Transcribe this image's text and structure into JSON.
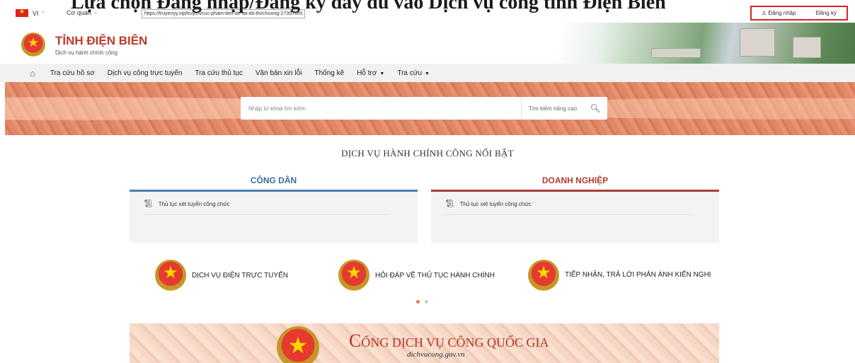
{
  "overlay": {
    "heading": "Lựa chọn Đăng nhập/Đăng ký đầy đủ vào Dịch vụ công tỉnh Điện Biên"
  },
  "topbar": {
    "lang": "VI",
    "agency": "Cơ quan",
    "url": "https://truyenyy.vip/truyen/cuc-pham-tien-de-tai-do-thi/chuong-2739.html",
    "login": "Đăng nhập",
    "register": "Đăng ký"
  },
  "header": {
    "title": "TỈNH ĐIỆN BIÊN",
    "subtitle": "Dịch vụ hành chính công"
  },
  "nav": {
    "items": [
      "Tra cứu hồ sơ",
      "Dịch vụ công trực tuyến",
      "Tra cứu thủ tục",
      "Văn bản xin lỗi",
      "Thống kê",
      "Hỗ trợ",
      "Tra cứu"
    ]
  },
  "search": {
    "placeholder": "Nhập từ khoá tìm kiếm",
    "advanced": "Tìm kiếm nâng cao"
  },
  "featured": {
    "title": "DỊCH VỤ HÀNH CHÍNH CÔNG NỔI BẬT",
    "citizen": {
      "tab": "CÔNG DÂN",
      "service": "Thủ tục xét tuyển công chức"
    },
    "business": {
      "tab": "DOANH NGHIỆP",
      "service": "Thủ tục xét tuyển công chức"
    }
  },
  "quick_links": [
    "DỊCH VỤ ĐIỆN TRỰC TUYẾN",
    "HỎI ĐÁP VỀ THỦ TỤC HÀNH CHÍNH",
    "TIẾP NHẬN, TRẢ LỜI PHẢN ÁNH KIẾN NGHỊ"
  ],
  "portal": {
    "brand_initial": "C",
    "brand_rest": "ỔNG DỊCH VỤ CÔNG QUỐC GIA",
    "domain": "dichvucong.gov.vn"
  },
  "colors": {
    "accent_red": "#c0392b",
    "citizen_blue": "#4a7eaa",
    "business_red": "#a84037"
  }
}
